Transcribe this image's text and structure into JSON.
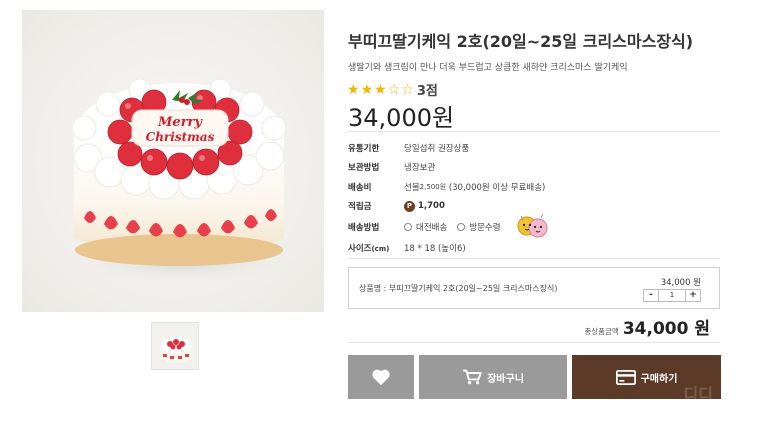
{
  "product": {
    "title": "부띠끄딸기케익 2호(20일~25일 크리스마스장식)",
    "description": "생딸기와 생크림이 만나 더욱 부드럽고 상큼한 새하얀 크리스마스 딸기케익",
    "rating": {
      "filled": 3,
      "total": 5,
      "text": "3점"
    },
    "price": "34,000원",
    "cake_topper_text": "Merry Christmas"
  },
  "info": {
    "expiry": {
      "label": "유통기한",
      "value": "당일섭취 권장상품"
    },
    "storage": {
      "label": "보관방법",
      "value": "냉장보관"
    },
    "shipping": {
      "label": "배송비",
      "value_main": "선불",
      "value_small": "2,500원",
      "value_rest": "(30,000원 이상 무료배송)"
    },
    "points": {
      "label": "적립금",
      "icon_text": "P",
      "value": "1,700"
    },
    "delivery": {
      "label": "배송방법",
      "option1": "대전배송",
      "option2": "방문수령"
    },
    "size": {
      "label": "사이즈",
      "label_small": "(cm)",
      "value": "18 * 18 (높이6)"
    }
  },
  "option": {
    "name": "상품명 : 부띠끄딸기케익 2호(20일~25일 크리스마스장식)",
    "price": "34,000 원",
    "qty": "1",
    "minus": "-",
    "plus": "+"
  },
  "total": {
    "label": "총상품금액",
    "price": "34,000 원"
  },
  "buttons": {
    "cart": "장바구니",
    "buy": "구매하기",
    "buy_ghost": "디디"
  },
  "colors": {
    "star": "#f2b705",
    "buy_button": "#5c3a28",
    "gray_button": "#9a9a9a",
    "point_badge": "#6b3f22"
  },
  "icons": [
    "heart-icon",
    "cart-icon",
    "card-icon",
    "point-icon",
    "star-icon",
    "radio-icon"
  ]
}
